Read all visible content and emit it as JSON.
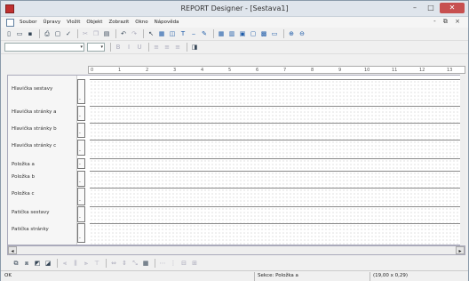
{
  "window": {
    "title": "REPORT Designer - [Sestava1]",
    "controls": {
      "minimize": "–",
      "maximize": "□",
      "close": "✕"
    },
    "mdi_controls": "- ⧉ ×"
  },
  "menu": [
    "Soubor",
    "Úpravy",
    "Vložit",
    "Objekt",
    "Zobrazit",
    "Okno",
    "Nápověda"
  ],
  "toolbar1": {
    "icons": [
      "new-icon",
      "open-icon",
      "save-icon",
      "print-icon",
      "preview-icon",
      "spell-icon",
      "cut-icon",
      "copy-icon",
      "paste-icon",
      "undo-icon",
      "redo-icon",
      "pointer-icon",
      "field-icon",
      "image-icon",
      "text-icon",
      "line-icon",
      "brush-icon",
      "table-icon",
      "chart-icon",
      "frame-icon",
      "box-icon",
      "grid-icon",
      "zoom-in-icon",
      "zoom-out-icon"
    ]
  },
  "toolbar2": {
    "font_name": "",
    "font_size": ""
  },
  "ruler": {
    "marks": [
      "0",
      "1",
      "2",
      "3",
      "4",
      "5",
      "6",
      "7",
      "8",
      "9",
      "10",
      "11",
      "12",
      "13"
    ]
  },
  "bands": [
    {
      "label": "Hlavička sestavy"
    },
    {
      "label": "Hlavička stránky a"
    },
    {
      "label": "Hlavička stránky b"
    },
    {
      "label": "Hlavička stránky c"
    },
    {
      "label": "Položka a"
    },
    {
      "label": "Položka b"
    },
    {
      "label": "Položka c"
    },
    {
      "label": "Patička sestavy"
    },
    {
      "label": "Patička stránky"
    }
  ],
  "bracket_symbol": "-",
  "scroll": {
    "left": "◂",
    "right": "▸"
  },
  "status": {
    "left": "OK",
    "selection": "Sekce: Položka a",
    "coords": "(19,00 x 0,29)"
  }
}
